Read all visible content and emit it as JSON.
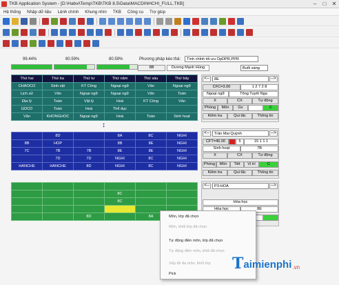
{
  "window": {
    "title": "TKB Application System - [D:\\Habvi\\Temp\\TKB\\TKB 8.5\\Data\\MACDINHCHI_FULL.TKB]",
    "min": "–",
    "max": "□",
    "close": "✕"
  },
  "menu": [
    "Hệ thống",
    "Nhập dữ liệu",
    "Lệnh chính",
    "Khung nhìn",
    "TKB",
    "Công cụ",
    "Trợ giúp"
  ],
  "progress": [
    {
      "label": "99.44%",
      "value": 99.44
    },
    {
      "label": "80.59%",
      "value": 80.59
    },
    {
      "label": "80.59%",
      "value": 80.59
    }
  ],
  "method": {
    "label": "Phương pháp kéo thả:",
    "value": "Tình chỉnh tối ưu OpDPR,PPR"
  },
  "class_box": "8B",
  "teacher_box": "Dương Mạnh Hùng",
  "session": "Buổi sáng",
  "grid1": {
    "header": [
      "Thứ hai",
      "Thứ ba",
      "Thứ tư",
      "Thứ năm",
      "Thứ sáu",
      "Thứ bảy"
    ],
    "rows": [
      [
        "CHAOCO",
        "Sinh vật",
        "KT Công",
        "Ngoại ngữ",
        "Văn",
        "Ngoại ngữ"
      ],
      [
        "Lịch sử",
        "Văn",
        "Ngoại ngữ",
        "Ngoại ngữ",
        "Văn",
        "Toán"
      ],
      [
        "Địa lý",
        "Toán",
        "Vật lý",
        "Hoá",
        "KT Công",
        "Văn"
      ],
      [
        "GDCD",
        "Toán",
        "Hoá",
        "Thể dục",
        "",
        ""
      ],
      [
        "Văn",
        "KHONGHOC",
        "Ngoại ngữ",
        "Hoá",
        "Toán",
        "Sinh hoạt"
      ]
    ]
  },
  "grid2": {
    "rows": [
      [
        "",
        "8D",
        "",
        "8A",
        "8C",
        "NGHI"
      ],
      [
        "8B",
        "HOP",
        "",
        "8B",
        "8E",
        "NGHI"
      ],
      [
        "7C",
        "7B",
        "7B",
        "8E",
        "8E",
        "NGHI"
      ],
      [
        "",
        "7D",
        "7D",
        "NGHI",
        "8C",
        "NGHI"
      ],
      [
        "HANCHE",
        "HANCHE",
        "8D",
        "NGHI",
        "8C",
        "NGHI"
      ]
    ]
  },
  "grid3": {
    "rows": [
      [
        "",
        "",
        "",
        "",
        "",
        ""
      ],
      [
        "",
        "",
        "",
        "8C",
        "",
        ""
      ],
      [
        "",
        "",
        "",
        "8C",
        "",
        ""
      ],
      [
        "",
        "",
        "",
        "",
        "",
        ""
      ],
      [
        "",
        "",
        "8D",
        "",
        "8A",
        ""
      ]
    ]
  },
  "panel1": {
    "nav_left": "<--",
    "nav_right": "-->",
    "select": "8E",
    "cfc_label": "CFC=3.00",
    "cfc_nums": "1 2 7 2 8",
    "subject": "Ngoại ngữ",
    "teacher": "Tông Tuyết Nga",
    "cells_x": "X",
    "cells_cx": "CX",
    "cells_td": "Tự động",
    "btn_room": "Phòng",
    "btn_subject": "Môn",
    "btn_gv": "Gv",
    "btn_c": "C",
    "check": "Kiểm tra",
    "rule": "Qui tắc",
    "info": "Thông tin"
  },
  "panel2": {
    "nav_left": "<--",
    "nav_right": "-->",
    "select": "Trần Mai Quỳnh",
    "cft_label": "CFT=46.00",
    "cft_value": "5",
    "cft_nums": "15 1 1 1",
    "subject": "Sinh hoạt",
    "cls": "7B",
    "cells_x": "X",
    "cells_cx": "CX",
    "cells_td": "Tự động",
    "btn_room": "Phòng",
    "btn_subject": "Môn",
    "btn_tiet": "Tiết",
    "btn_vitri": "Vị trí",
    "btn_c": "C",
    "check": "Kiểm tra",
    "rule": "Qui tắc",
    "info": "Thông tin"
  },
  "panel3": {
    "nav_left": "<--",
    "nav_right": "-->",
    "select": "P3-HOA",
    "room_subject": "Hóa học",
    "room_subject2": "Hóa học",
    "room_cls": "8E"
  },
  "context_menu": [
    {
      "label": "Môn, lớp đã chọn",
      "enabled": true
    },
    {
      "label": "Môn, khối lớp đã chọn",
      "enabled": false
    },
    {
      "label": "Tự động điền môn, lớp đã chọn",
      "enabled": true
    },
    {
      "label": "Tự động điền môn, khối đã chọn",
      "enabled": false
    },
    {
      "label": "Xếp tối đa môn, khối lớp",
      "enabled": false
    },
    {
      "label": "Pick",
      "enabled": true
    }
  ],
  "watermark": {
    "first": "T",
    "rest": "aimienphi",
    "tld": ".vn"
  }
}
